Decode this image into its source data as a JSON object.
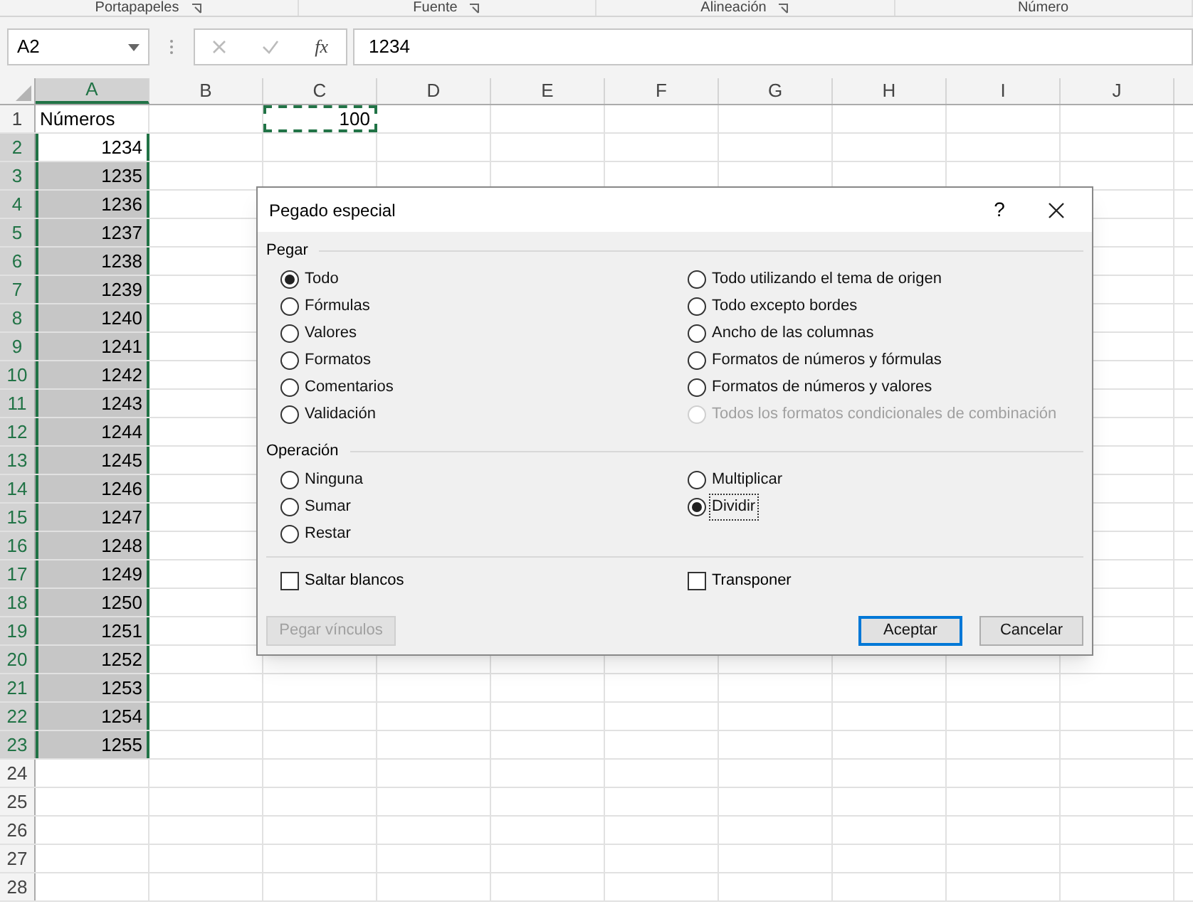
{
  "ribbon_groups": [
    {
      "label": "Portapapeles",
      "launcher": true
    },
    {
      "label": "Fuente",
      "launcher": true
    },
    {
      "label": "Alineación",
      "launcher": true
    },
    {
      "label": "Número",
      "launcher": false
    }
  ],
  "formula_bar": {
    "name_box": "A2",
    "function_label": "fx",
    "value": "1234"
  },
  "columns": [
    {
      "label": "A",
      "selected": true
    },
    {
      "label": "B",
      "selected": false
    },
    {
      "label": "C",
      "selected": false
    },
    {
      "label": "D",
      "selected": false
    },
    {
      "label": "E",
      "selected": false
    },
    {
      "label": "F",
      "selected": false
    },
    {
      "label": "G",
      "selected": false
    },
    {
      "label": "H",
      "selected": false
    },
    {
      "label": "I",
      "selected": false
    },
    {
      "label": "J",
      "selected": false
    }
  ],
  "rows": [
    {
      "label": "1",
      "selected": false,
      "cells": [
        {
          "text": "Números",
          "kind": "text",
          "selected": false
        },
        {},
        {
          "text": "100",
          "kind": "number",
          "selected": false,
          "copied": true
        }
      ]
    },
    {
      "label": "2",
      "selected": true,
      "cells": [
        {
          "text": "1234",
          "kind": "number",
          "selected": true,
          "active": true
        }
      ]
    },
    {
      "label": "3",
      "selected": true,
      "cells": [
        {
          "text": "1235",
          "kind": "number",
          "selected": true
        }
      ]
    },
    {
      "label": "4",
      "selected": true,
      "cells": [
        {
          "text": "1236",
          "kind": "number",
          "selected": true
        }
      ]
    },
    {
      "label": "5",
      "selected": true,
      "cells": [
        {
          "text": "1237",
          "kind": "number",
          "selected": true
        }
      ]
    },
    {
      "label": "6",
      "selected": true,
      "cells": [
        {
          "text": "1238",
          "kind": "number",
          "selected": true
        }
      ]
    },
    {
      "label": "7",
      "selected": true,
      "cells": [
        {
          "text": "1239",
          "kind": "number",
          "selected": true
        }
      ]
    },
    {
      "label": "8",
      "selected": true,
      "cells": [
        {
          "text": "1240",
          "kind": "number",
          "selected": true
        }
      ]
    },
    {
      "label": "9",
      "selected": true,
      "cells": [
        {
          "text": "1241",
          "kind": "number",
          "selected": true
        }
      ]
    },
    {
      "label": "10",
      "selected": true,
      "cells": [
        {
          "text": "1242",
          "kind": "number",
          "selected": true
        }
      ]
    },
    {
      "label": "11",
      "selected": true,
      "cells": [
        {
          "text": "1243",
          "kind": "number",
          "selected": true
        }
      ]
    },
    {
      "label": "12",
      "selected": true,
      "cells": [
        {
          "text": "1244",
          "kind": "number",
          "selected": true
        }
      ]
    },
    {
      "label": "13",
      "selected": true,
      "cells": [
        {
          "text": "1245",
          "kind": "number",
          "selected": true
        }
      ]
    },
    {
      "label": "14",
      "selected": true,
      "cells": [
        {
          "text": "1246",
          "kind": "number",
          "selected": true
        }
      ]
    },
    {
      "label": "15",
      "selected": true,
      "cells": [
        {
          "text": "1247",
          "kind": "number",
          "selected": true
        }
      ]
    },
    {
      "label": "16",
      "selected": true,
      "cells": [
        {
          "text": "1248",
          "kind": "number",
          "selected": true
        }
      ]
    },
    {
      "label": "17",
      "selected": true,
      "cells": [
        {
          "text": "1249",
          "kind": "number",
          "selected": true
        }
      ]
    },
    {
      "label": "18",
      "selected": true,
      "cells": [
        {
          "text": "1250",
          "kind": "number",
          "selected": true
        }
      ]
    },
    {
      "label": "19",
      "selected": true,
      "cells": [
        {
          "text": "1251",
          "kind": "number",
          "selected": true
        }
      ]
    },
    {
      "label": "20",
      "selected": true,
      "cells": [
        {
          "text": "1252",
          "kind": "number",
          "selected": true
        }
      ]
    },
    {
      "label": "21",
      "selected": true,
      "cells": [
        {
          "text": "1253",
          "kind": "number",
          "selected": true
        }
      ]
    },
    {
      "label": "22",
      "selected": true,
      "cells": [
        {
          "text": "1254",
          "kind": "number",
          "selected": true
        }
      ]
    },
    {
      "label": "23",
      "selected": true,
      "cells": [
        {
          "text": "1255",
          "kind": "number",
          "selected": true
        }
      ]
    },
    {
      "label": "24",
      "selected": false
    },
    {
      "label": "25",
      "selected": false
    },
    {
      "label": "26",
      "selected": false
    },
    {
      "label": "27",
      "selected": false
    },
    {
      "label": "28",
      "selected": false
    }
  ],
  "dialog": {
    "title": "Pegado especial",
    "help": "?",
    "paste": {
      "label": "Pegar",
      "left": [
        {
          "label": "Todo",
          "selected": true,
          "disabled": false
        },
        {
          "label": "Fórmulas",
          "selected": false,
          "disabled": false
        },
        {
          "label": "Valores",
          "selected": false,
          "disabled": false
        },
        {
          "label": "Formatos",
          "selected": false,
          "disabled": false
        },
        {
          "label": "Comentarios",
          "selected": false,
          "disabled": false
        },
        {
          "label": "Validación",
          "selected": false,
          "disabled": false
        }
      ],
      "right": [
        {
          "label": "Todo utilizando el tema de origen",
          "selected": false,
          "disabled": false
        },
        {
          "label": "Todo excepto bordes",
          "selected": false,
          "disabled": false
        },
        {
          "label": "Ancho de las columnas",
          "selected": false,
          "disabled": false
        },
        {
          "label": "Formatos de números y fórmulas",
          "selected": false,
          "disabled": false
        },
        {
          "label": "Formatos de números y valores",
          "selected": false,
          "disabled": false
        },
        {
          "label": "Todos los formatos condicionales de combinación",
          "selected": false,
          "disabled": true
        }
      ]
    },
    "operation": {
      "label": "Operación",
      "left": [
        {
          "label": "Ninguna",
          "selected": false,
          "focused": false
        },
        {
          "label": "Sumar",
          "selected": false,
          "focused": false
        },
        {
          "label": "Restar",
          "selected": false,
          "focused": false
        }
      ],
      "right": [
        {
          "label": "Multiplicar",
          "selected": false,
          "focused": false
        },
        {
          "label": "Dividir",
          "selected": true,
          "focused": true
        }
      ]
    },
    "checkboxes": [
      {
        "label": "Saltar blancos",
        "checked": false
      },
      {
        "label": "Transponer",
        "checked": false
      }
    ],
    "buttons": [
      {
        "label": "Pegar vínculos",
        "kind": "secondary",
        "disabled": true
      },
      {
        "label": "Aceptar",
        "kind": "default",
        "disabled": false
      },
      {
        "label": "Cancelar",
        "kind": "normal",
        "disabled": false
      }
    ]
  }
}
